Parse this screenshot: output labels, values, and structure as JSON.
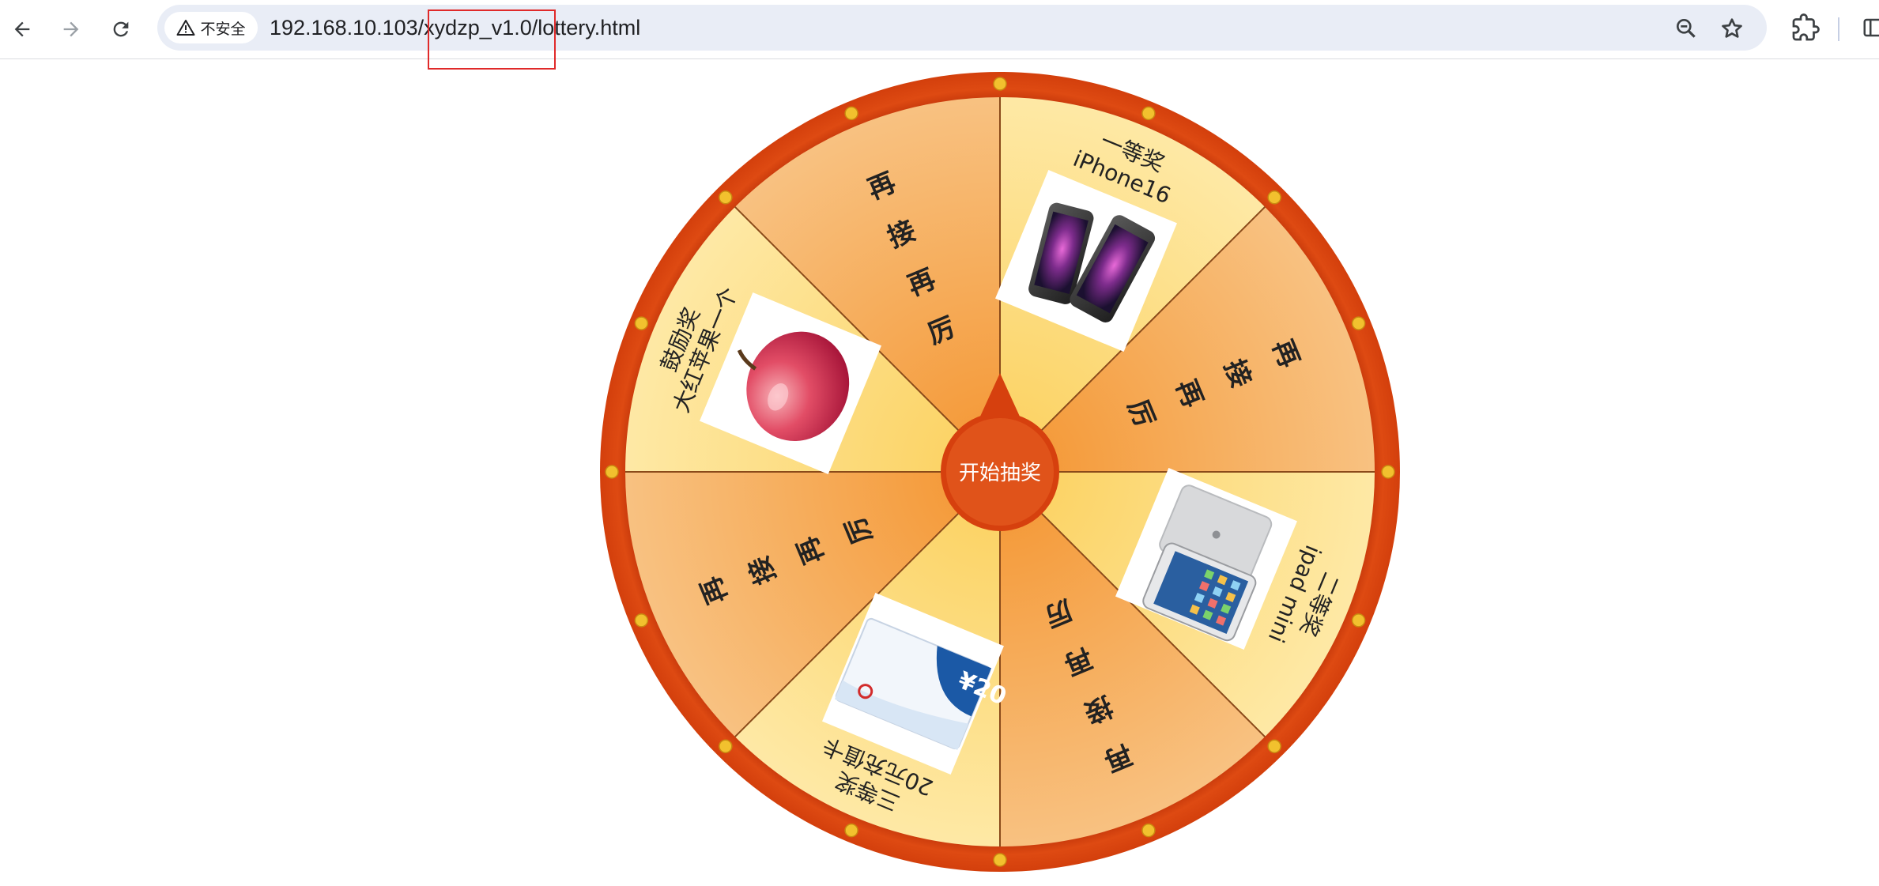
{
  "browser": {
    "security_label": "不安全",
    "url": "192.168.10.103/xydzp_v1.0/lottery.html",
    "icons": [
      "back-arrow-icon",
      "forward-arrow-icon",
      "reload-icon",
      "warning-icon",
      "zoom-icon",
      "star-icon",
      "extensions-icon",
      "side-panel-icon"
    ]
  },
  "wheel": {
    "start_label": "开始抽奖",
    "segments": [
      {
        "title": "一等奖",
        "subtitle": "iPhone16",
        "image": "iphone-image"
      },
      {
        "title": "再接再厉"
      },
      {
        "title": "二等奖",
        "subtitle": "ipad mini",
        "image": "ipad-image"
      },
      {
        "title": "再接再厉"
      },
      {
        "title": "三等奖",
        "subtitle": "20元充值卡",
        "image": "recharge-card-image",
        "card_label": "¥20"
      },
      {
        "title": "再接再厉"
      },
      {
        "title": "鼓励奖",
        "subtitle": "大红苹果一个",
        "image": "apple-image"
      },
      {
        "title": "再接再厉"
      }
    ],
    "colors": {
      "rim": "#d6400e",
      "rim_dots": "#f2c12e",
      "segment_light": "#fde49a",
      "segment_dark": "#f5a04a",
      "center_button": "#d6400e"
    }
  }
}
